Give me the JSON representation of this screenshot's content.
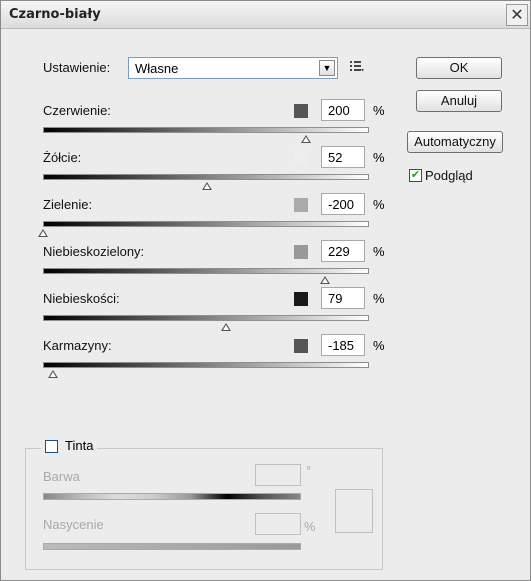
{
  "window": {
    "title": "Czarno-biały",
    "close_glyph": "✕"
  },
  "preset": {
    "label": "Ustawienie:",
    "value": "Własne"
  },
  "buttons": {
    "ok": "OK",
    "cancel": "Anuluj",
    "auto": "Automatyczny"
  },
  "preview": {
    "label": "Podgląd",
    "checked": true
  },
  "percent_sign": "%",
  "sliders": [
    {
      "label": "Czerwienie:",
      "value": "200",
      "swatch": "#555555",
      "grad_from": "#000000",
      "grad_to": "#ffffff",
      "level": 0.806
    },
    {
      "label": "Żółcie:",
      "value": "52",
      "swatch": "#eeeeee",
      "grad_from": "#000000",
      "grad_to": "#ffffff",
      "level": 0.504
    },
    {
      "label": "Zielenie:",
      "value": "-200",
      "swatch": "#aaaaaa",
      "grad_from": "#000000",
      "grad_to": "#ffffff",
      "level": 0.0
    },
    {
      "label": "Niebieskozielony:",
      "value": "229",
      "swatch": "#999999",
      "grad_from": "#000000",
      "grad_to": "#ffffff",
      "level": 0.866
    },
    {
      "label": "Niebieskości:",
      "value": "79",
      "swatch": "#1a1a1a",
      "grad_from": "#000000",
      "grad_to": "#ffffff",
      "level": 0.56
    },
    {
      "label": "Karmazyny:",
      "value": "-185",
      "swatch": "#555555",
      "grad_from": "#000000",
      "grad_to": "#ffffff",
      "level": 0.031
    }
  ],
  "tint": {
    "label": "Tinta",
    "checked": false,
    "hue_label": "Barwa",
    "hue_unit": "°",
    "saturation_label": "Nasycenie",
    "saturation_unit": "%"
  }
}
